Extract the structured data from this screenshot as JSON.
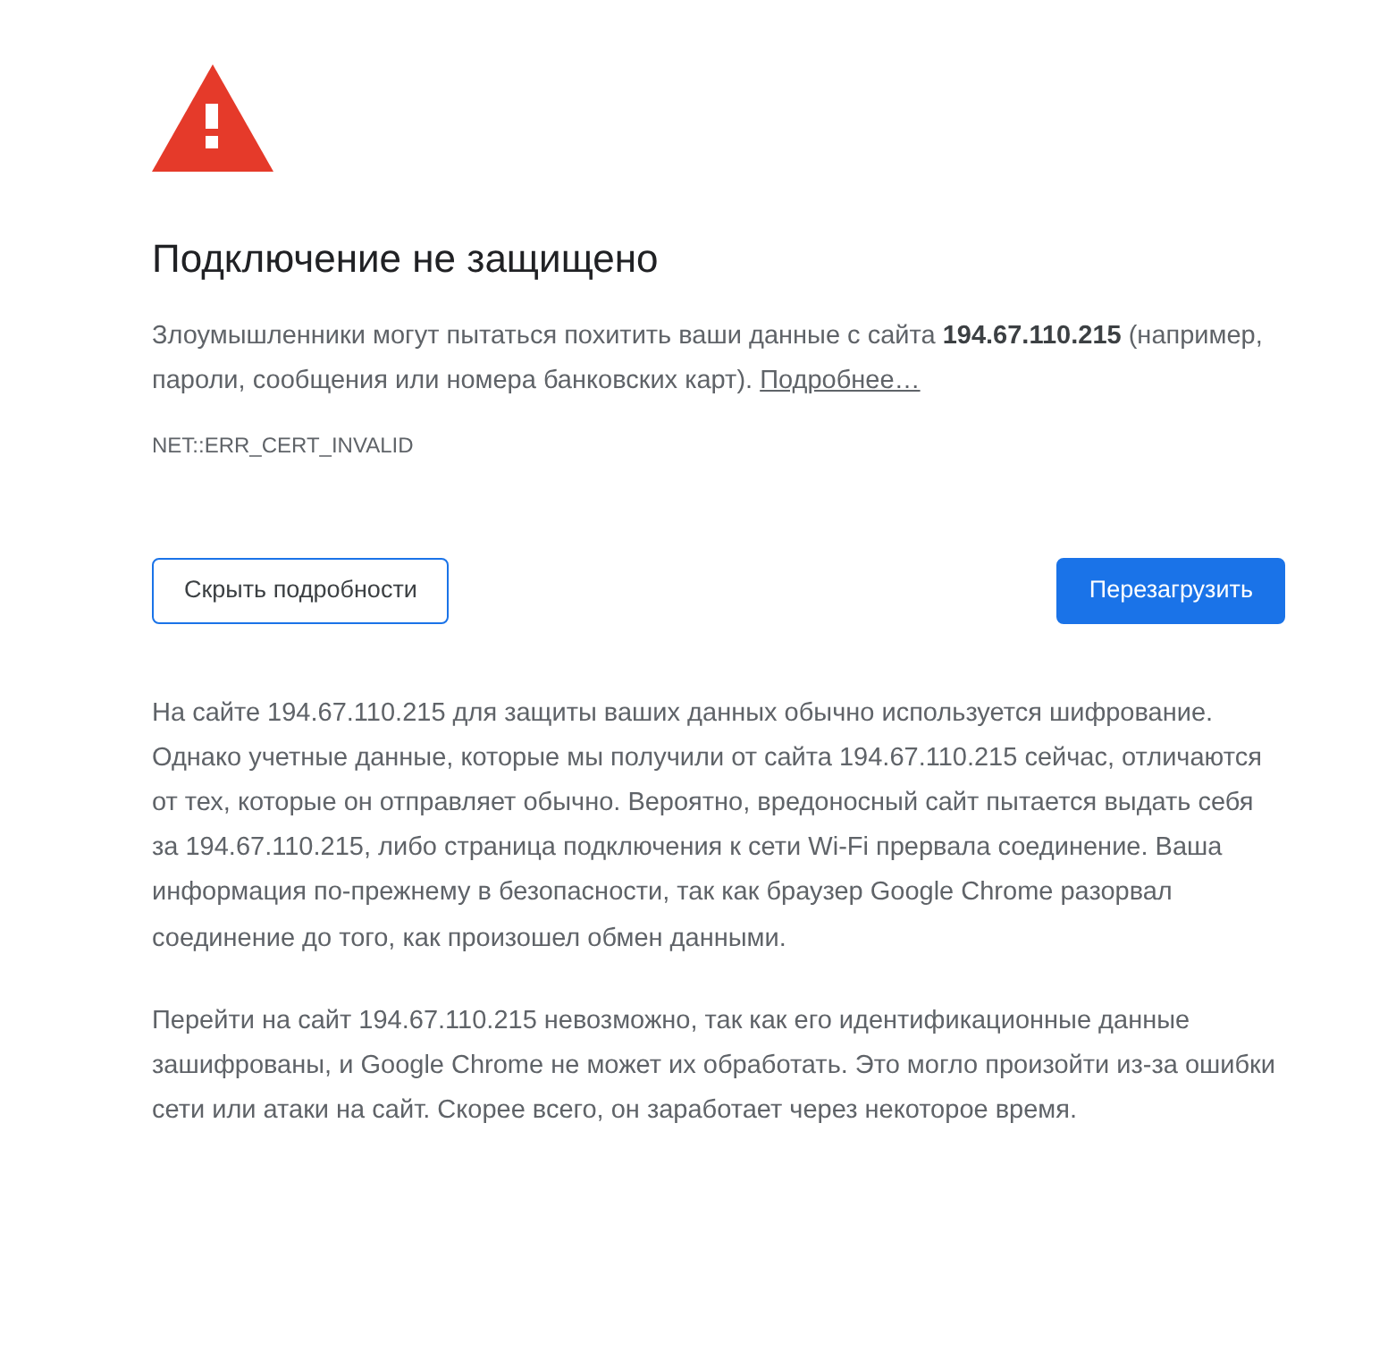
{
  "title": "Подключение не защищено",
  "intro": "Злоумышленники могут пытаться похитить ваши данные с сайта **194.67.110.215** (например, пароли, сообщения или номера банковских карт).",
  "details_link": "Подробнее…",
  "error_code": "NET::ERR_CERT_INVALID",
  "buttons": [
    {
      "label": "Скрыть подробности",
      "kind": "outline"
    },
    {
      "label": "Перезагрузить",
      "kind": "primary"
    }
  ],
  "details": [
    "На сайте 194.67.110.215 для защиты ваших данных обычно используется шифрование. Однако учетные данные, которые мы получили от сайта 194.67.110.215 сейчас, отличаются от тех, которые он отправляет обычно. Вероятно, вредоносный сайт пытается выдать себя за 194.67.110.215, либо страница подключения к сети Wi-Fi прервала соединение. Ваша информация по-прежнему в безопасности, так как браузер Google Chrome разорвал соединение до того, как произошел обмен данными.",
    "Перейти на сайт 194.67.110.215 невозможно, так как его идентификационные данные зашифрованы, и Google Chrome не может их обработать. Это могло произойти из-за ошибки сети или атаки на сайт. Скорее всего, он заработает через некоторое время."
  ]
}
